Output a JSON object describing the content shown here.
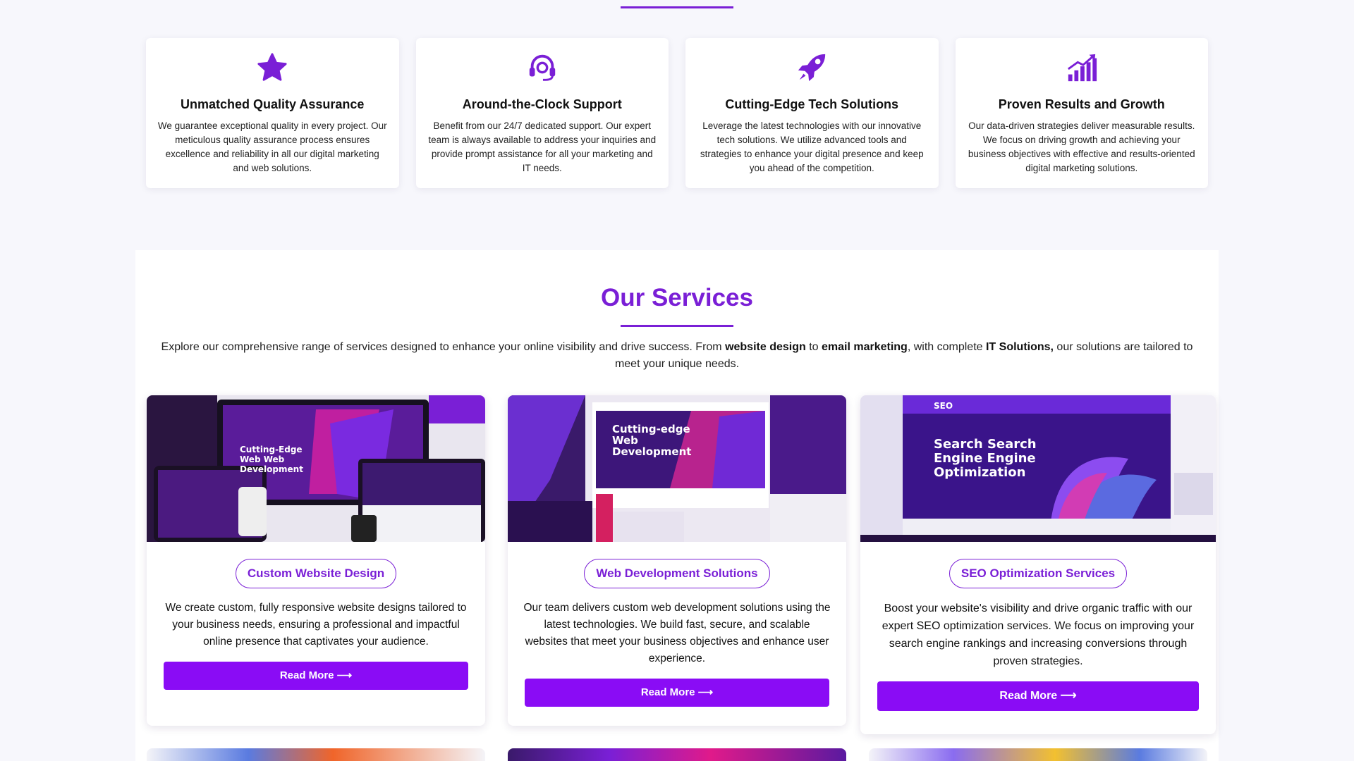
{
  "features": [
    {
      "icon": "star-icon",
      "title": "Unmatched Quality Assurance",
      "text": "We guarantee exceptional quality in every project. Our meticulous quality assurance process ensures excellence and reliability in all our digital marketing and web solutions."
    },
    {
      "icon": "headset-icon",
      "title": "Around-the-Clock Support",
      "text": "Benefit from our 24/7 dedicated support. Our expert team is always available to address your inquiries and provide prompt assistance for all your marketing and IT needs."
    },
    {
      "icon": "rocket-icon",
      "title": "Cutting-Edge Tech Solutions",
      "text": "Leverage the latest technologies with our innovative tech solutions. We utilize advanced tools and strategies to enhance your digital presence and keep you ahead of the competition."
    },
    {
      "icon": "growth-chart-icon",
      "title": "Proven Results and Growth",
      "text": "Our data-driven strategies deliver measurable results. We focus on driving growth and achieving your business objectives with effective and results-oriented digital marketing solutions."
    }
  ],
  "services": {
    "title": "Our Services",
    "intro": {
      "part1": "Explore our comprehensive range of services designed to enhance your online visibility and drive success. From ",
      "bold1": "website design",
      "part2": " to ",
      "bold2": "email marketing",
      "part3": ", with complete ",
      "bold3": "IT Solutions,",
      "part4": " our solutions are tailored to meet your unique needs."
    },
    "cards": [
      {
        "title": "Custom Website Design",
        "image_caption": "Cutting-Edge Web Web Development",
        "text": "We create custom, fully responsive website designs tailored to your business needs, ensuring a professional and impactful online presence that captivates your audience.",
        "button": "Read More ⟶"
      },
      {
        "title": "Web Development Solutions",
        "image_caption": "Cutting-edge Web Development",
        "text": "Our team delivers custom web development solutions using the latest technologies. We build fast, secure, and scalable websites that meet your business objectives and enhance user experience.",
        "button": "Read More ⟶"
      },
      {
        "title": "SEO Optimization Services",
        "image_caption": "Search Search Engine Engine Optimization",
        "image_badge": "SEO",
        "text": "Boost your website's visibility and drive organic traffic with our expert SEO optimization services. We focus on improving your search engine rankings and increasing conversions through proven strategies.",
        "button": "Read More ⟶"
      }
    ]
  },
  "colors": {
    "accent": "#7a1fd6",
    "button": "#8a0cf5",
    "page_bg": "#f7f7fc"
  }
}
